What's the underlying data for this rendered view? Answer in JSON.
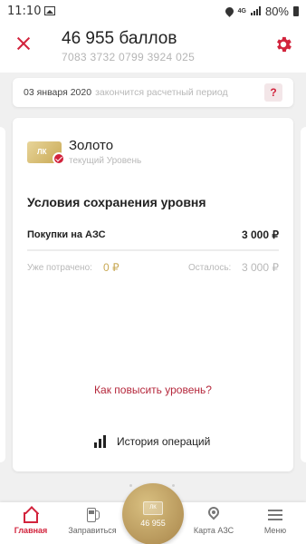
{
  "status_bar": {
    "time": "11:10",
    "network": "4G",
    "battery": "80%"
  },
  "header": {
    "title": "46 955 баллов",
    "card_number": "7083 3732 0799 3924 025"
  },
  "period": {
    "date": "03 января 2020",
    "text": "закончится расчетный период",
    "help": "?"
  },
  "level": {
    "name": "Золото",
    "caption": "текущий Уровень",
    "card_logo": "ЛК"
  },
  "conditions": {
    "title": "Условия сохранения уровня",
    "purchase_label": "Покупки на АЗС",
    "purchase_value": "3 000 ₽",
    "spent_label": "Уже потрачено:",
    "spent_value": "0 ₽",
    "remaining_label": "Осталось:",
    "remaining_value": "3 000 ₽"
  },
  "links": {
    "upgrade": "Как повысить уровень?",
    "history": "История операций"
  },
  "bottom_nav": {
    "home": "Главная",
    "refuel": "Заправиться",
    "center_value": "46 955",
    "center_logo": "ЛК",
    "map": "Карта АЗС",
    "menu": "Меню"
  },
  "colors": {
    "accent": "#d2233c",
    "gold": "#c9a955"
  }
}
